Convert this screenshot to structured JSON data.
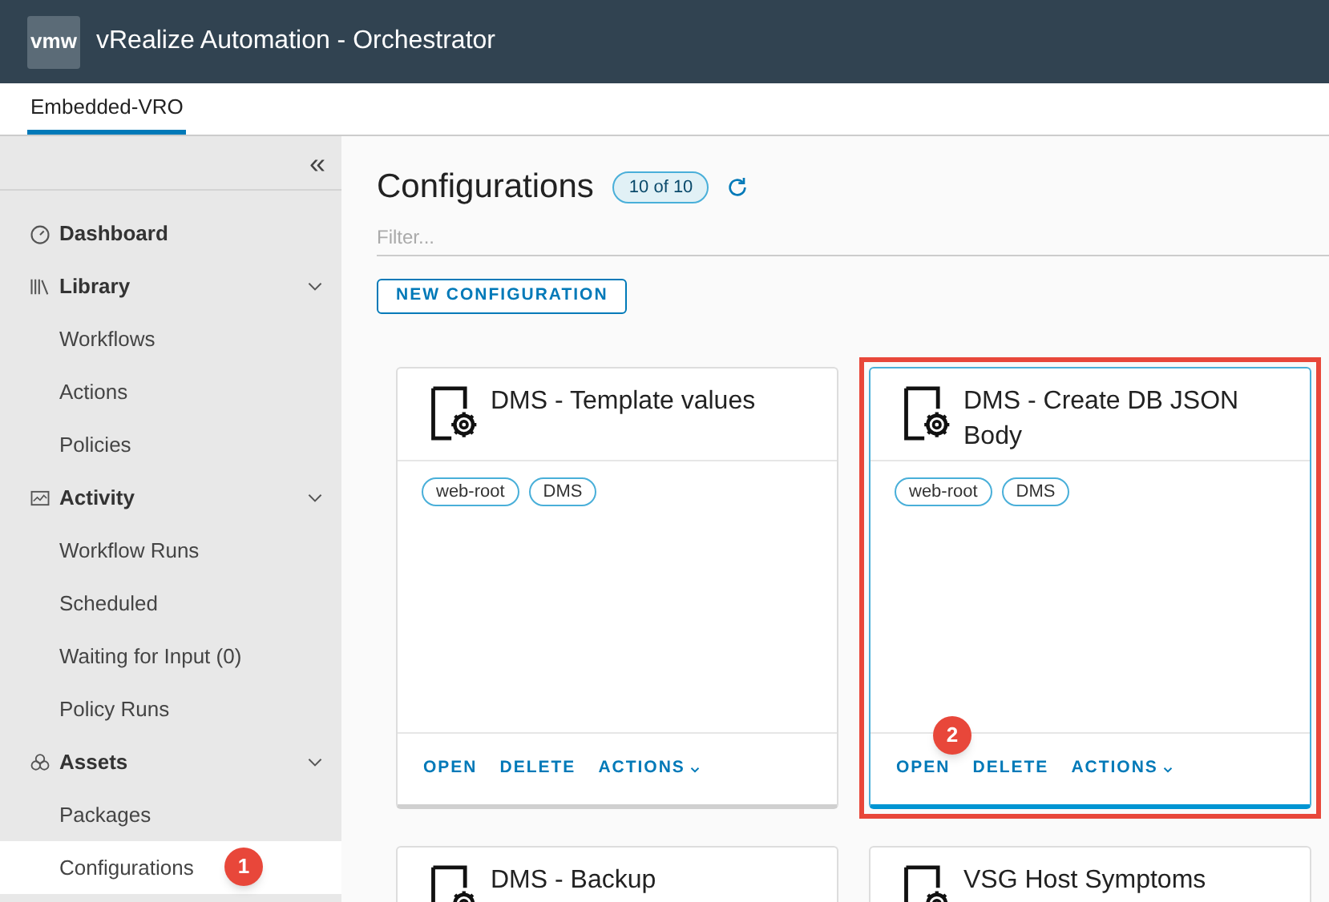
{
  "header": {
    "logo": "vmw",
    "title": "vRealize Automation - Orchestrator"
  },
  "tabs": [
    {
      "label": "Embedded-VRO",
      "selected": true
    }
  ],
  "sidebar": {
    "collapse": "«",
    "items": [
      {
        "label": "Dashboard"
      },
      {
        "label": "Library",
        "expanded": true,
        "children": [
          {
            "label": "Workflows",
            "selected": false
          },
          {
            "label": "Actions",
            "selected": false
          },
          {
            "label": "Policies",
            "selected": false
          }
        ]
      },
      {
        "label": "Activity",
        "expanded": true,
        "children": [
          {
            "label": "Workflow Runs",
            "selected": false
          },
          {
            "label": "Scheduled",
            "selected": false
          },
          {
            "label": "Waiting for Input (0)",
            "selected": false
          },
          {
            "label": "Policy Runs",
            "selected": false
          }
        ]
      },
      {
        "label": "Assets",
        "expanded": true,
        "children": [
          {
            "label": "Packages",
            "selected": false
          },
          {
            "label": "Configurations",
            "selected": true,
            "annotation": "1"
          }
        ]
      }
    ]
  },
  "page": {
    "title": "Configurations",
    "count": "10 of 10",
    "filter": {
      "placeholder": "Filter..."
    },
    "new_button": "NEW CONFIGURATION"
  },
  "cards": [
    {
      "title": "DMS - Template values",
      "tags": [
        "web-root",
        "DMS"
      ],
      "actions": [
        "OPEN",
        "DELETE",
        "ACTIONS"
      ],
      "highlighted": false
    },
    {
      "title": "DMS - Create DB JSON Body",
      "tags": [
        "web-root",
        "DMS"
      ],
      "actions": [
        "OPEN",
        "DELETE",
        "ACTIONS"
      ],
      "highlighted": true,
      "annotation": "2"
    },
    {
      "title": "DMS - Backup",
      "highlighted": false
    },
    {
      "title": "VSG Host Symptoms",
      "highlighted": false
    }
  ]
}
